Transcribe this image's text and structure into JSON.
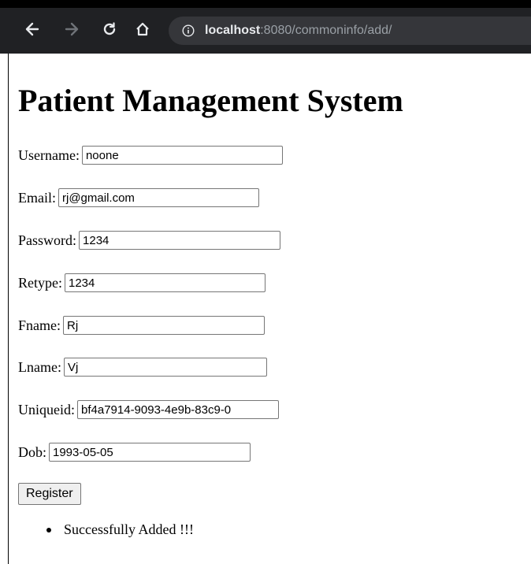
{
  "browser": {
    "url_prefix": "",
    "url_host": "localhost",
    "url_rest": ":8080/commoninfo/add/",
    "icons": {
      "back": "arrow-left-icon",
      "forward": "arrow-right-icon",
      "reload": "reload-icon",
      "home": "home-icon",
      "site_info": "info-icon"
    },
    "colors": {
      "toolbar": "#202124",
      "omnibox": "#35363a"
    }
  },
  "page": {
    "title": "Patient Management System",
    "fields": [
      {
        "label": "Username:",
        "value": "noone"
      },
      {
        "label": "Email:",
        "value": "rj@gmail.com"
      },
      {
        "label": "Password:",
        "value": "1234"
      },
      {
        "label": "Retype:",
        "value": "1234"
      },
      {
        "label": "Fname:",
        "value": "Rj"
      },
      {
        "label": "Lname:",
        "value": "Vj"
      },
      {
        "label": "Uniqueid:",
        "value": "bf4a7914-9093-4e9b-83c9-0"
      },
      {
        "label": "Dob:",
        "value": "1993-05-05"
      }
    ],
    "register_label": "Register",
    "messages": [
      "Successfully Added !!!"
    ]
  }
}
